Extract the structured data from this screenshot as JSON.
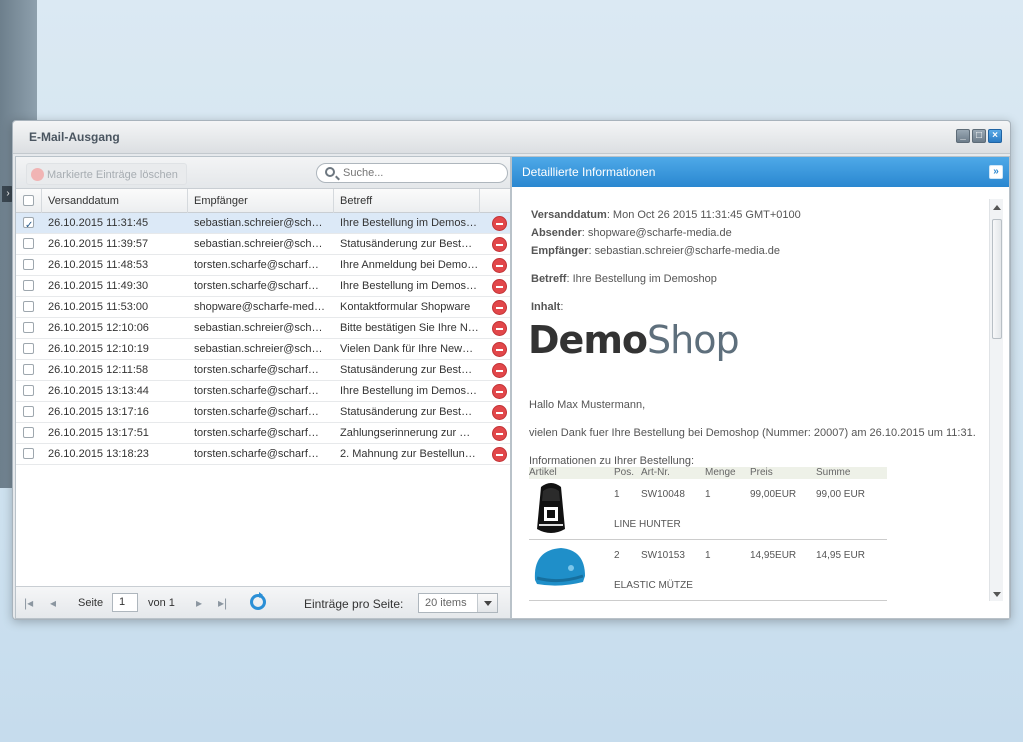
{
  "window": {
    "title": "E-Mail-Ausgang"
  },
  "toolbar": {
    "delete_label": "Markierte Einträge löschen"
  },
  "search": {
    "placeholder": "Suche..."
  },
  "grid": {
    "columns": [
      "Versanddatum",
      "Empfänger",
      "Betreff"
    ],
    "rows": [
      {
        "date": "26.10.2015 11:31:45",
        "to": "sebastian.schreier@sch…",
        "subject": "Ihre Bestellung im Demos…",
        "checked": true
      },
      {
        "date": "26.10.2015 11:39:57",
        "to": "sebastian.schreier@sch…",
        "subject": "Statusänderung zur Best…",
        "checked": false
      },
      {
        "date": "26.10.2015 11:48:53",
        "to": "torsten.scharfe@scharf…",
        "subject": "Ihre Anmeldung bei Demo…",
        "checked": false
      },
      {
        "date": "26.10.2015 11:49:30",
        "to": "torsten.scharfe@scharf…",
        "subject": "Ihre Bestellung im Demos…",
        "checked": false
      },
      {
        "date": "26.10.2015 11:53:00",
        "to": "shopware@scharfe-med…",
        "subject": "Kontaktformular Shopware",
        "checked": false
      },
      {
        "date": "26.10.2015 12:10:06",
        "to": "sebastian.schreier@sch…",
        "subject": "Bitte bestätigen Sie Ihre N…",
        "checked": false
      },
      {
        "date": "26.10.2015 12:10:19",
        "to": "sebastian.schreier@sch…",
        "subject": "Vielen Dank für Ihre New…",
        "checked": false
      },
      {
        "date": "26.10.2015 12:11:58",
        "to": "torsten.scharfe@scharf…",
        "subject": "Statusänderung zur Best…",
        "checked": false
      },
      {
        "date": "26.10.2015 13:13:44",
        "to": "torsten.scharfe@scharf…",
        "subject": "Ihre Bestellung im Demos…",
        "checked": false
      },
      {
        "date": "26.10.2015 13:17:16",
        "to": "torsten.scharfe@scharf…",
        "subject": "Statusänderung zur Best…",
        "checked": false
      },
      {
        "date": "26.10.2015 13:17:51",
        "to": "torsten.scharfe@scharf…",
        "subject": "Zahlungserinnerung zur …",
        "checked": false
      },
      {
        "date": "26.10.2015 13:18:23",
        "to": "torsten.scharfe@scharf…",
        "subject": "2. Mahnung zur Bestellun…",
        "checked": false
      }
    ]
  },
  "pager": {
    "page_label": "Seite",
    "page_value": "1",
    "of_label": "von 1",
    "per_page_label": "Einträge pro Seite:",
    "per_page_value": "20 items"
  },
  "detail": {
    "header": "Detaillierte Informationen",
    "sent_label": "Versanddatum",
    "sent_value": ": Mon Oct 26 2015 11:31:45 GMT+0100",
    "from_label": "Absender",
    "from_value": ": shopware@scharfe-media.de",
    "to_label": "Empfänger",
    "to_value": ": sebastian.schreier@scharfe-media.de",
    "subject_label": "Betreff",
    "subject_value": ": Ihre Bestellung im Demoshop",
    "content_label": "Inhalt",
    "content_colon": ":",
    "logo_bold": "Demo",
    "logo_light": "Shop",
    "greeting": "Hallo Max Mustermann,",
    "thanks": "vielen Dank fuer Ihre Bestellung bei Demoshop (Nummer: 20007) am 26.10.2015 um 11:31.",
    "info": "Informationen zu Ihrer Bestellung:",
    "order_columns": [
      "Artikel",
      "Pos.",
      "Art-Nr.",
      "Menge",
      "Preis",
      "Summe"
    ],
    "items": [
      {
        "pos": "1",
        "artnr": "SW10048",
        "qty": "1",
        "price": "99,00EUR",
        "sum": "99,00 EUR",
        "name": "LINE HUNTER"
      },
      {
        "pos": "2",
        "artnr": "SW10153",
        "qty": "1",
        "price": "14,95EUR",
        "sum": "14,95 EUR",
        "name": "ELASTIC MÜTZE"
      }
    ]
  },
  "colors": {
    "accent": "#2a87d0",
    "delete": "#e2474a",
    "selected_row": "#dce9f7"
  }
}
